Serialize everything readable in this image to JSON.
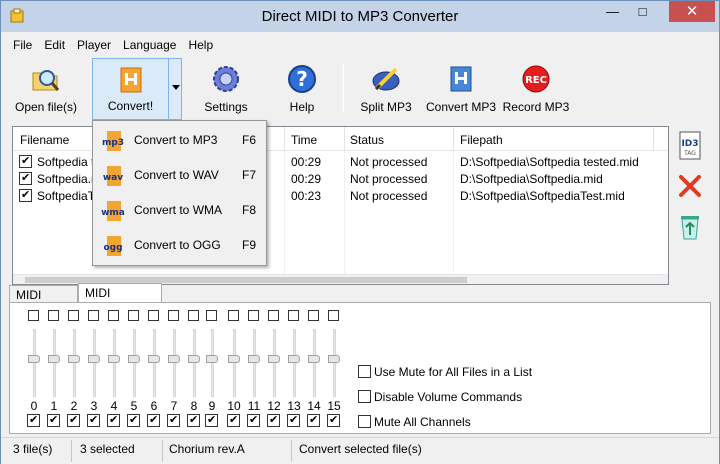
{
  "window": {
    "title": "Direct MIDI to MP3 Converter"
  },
  "menu": {
    "items": [
      "File",
      "Edit",
      "Player",
      "Language",
      "Help"
    ]
  },
  "toolbar": {
    "open": "Open file(s)",
    "convert": "Convert!",
    "settings": "Settings",
    "help": "Help",
    "split": "Split MP3",
    "convert_mp3": "Convert MP3",
    "record": "Record MP3",
    "record_badge": "REC"
  },
  "filelist": {
    "columns": [
      "Filename",
      "Time",
      "Status",
      "Filepath"
    ],
    "rows": [
      {
        "filename": "Softpedia te",
        "time": "00:29",
        "status": "Not processed",
        "path": "D:\\Softpedia\\Softpedia tested.mid",
        "checked": true
      },
      {
        "filename": "Softpedia.m",
        "time": "00:29",
        "status": "Not processed",
        "path": "D:\\Softpedia\\Softpedia.mid",
        "checked": true
      },
      {
        "filename": "SoftpediaTest",
        "time": "00:23",
        "status": "Not processed",
        "path": "D:\\Softpedia\\SoftpediaTest.mid",
        "checked": true
      }
    ]
  },
  "dropdown": {
    "items": [
      {
        "badge": "mp3",
        "label": "Convert to MP3",
        "key": "F6"
      },
      {
        "badge": "wav",
        "label": "Convert to WAV",
        "key": "F7"
      },
      {
        "badge": "wma",
        "label": "Convert to WMA",
        "key": "F8"
      },
      {
        "badge": "ogg",
        "label": "Convert to OGG",
        "key": "F9"
      }
    ]
  },
  "sidebar": {
    "id3_badge": "ID3",
    "id3_tag": "TAG"
  },
  "tabs": [
    "MIDI Player",
    "MIDI Channels"
  ],
  "channels": [
    "0",
    "1",
    "2",
    "3",
    "4",
    "5",
    "6",
    "7",
    "8",
    "9",
    "10",
    "11",
    "12",
    "13",
    "14",
    "15"
  ],
  "options": {
    "mute_all_in_list": "Use Mute for All Files in a List",
    "disable_volume": "Disable Volume Commands",
    "mute_all_channels": "Mute All Channels"
  },
  "status": {
    "files": "3 file(s)",
    "selected": "3 selected",
    "engine": "Chorium rev.A",
    "hint": "Convert selected file(s)"
  },
  "colors": {
    "accent": "#7eb4ea",
    "close": "#c75050",
    "rec": "#e41e1e"
  }
}
